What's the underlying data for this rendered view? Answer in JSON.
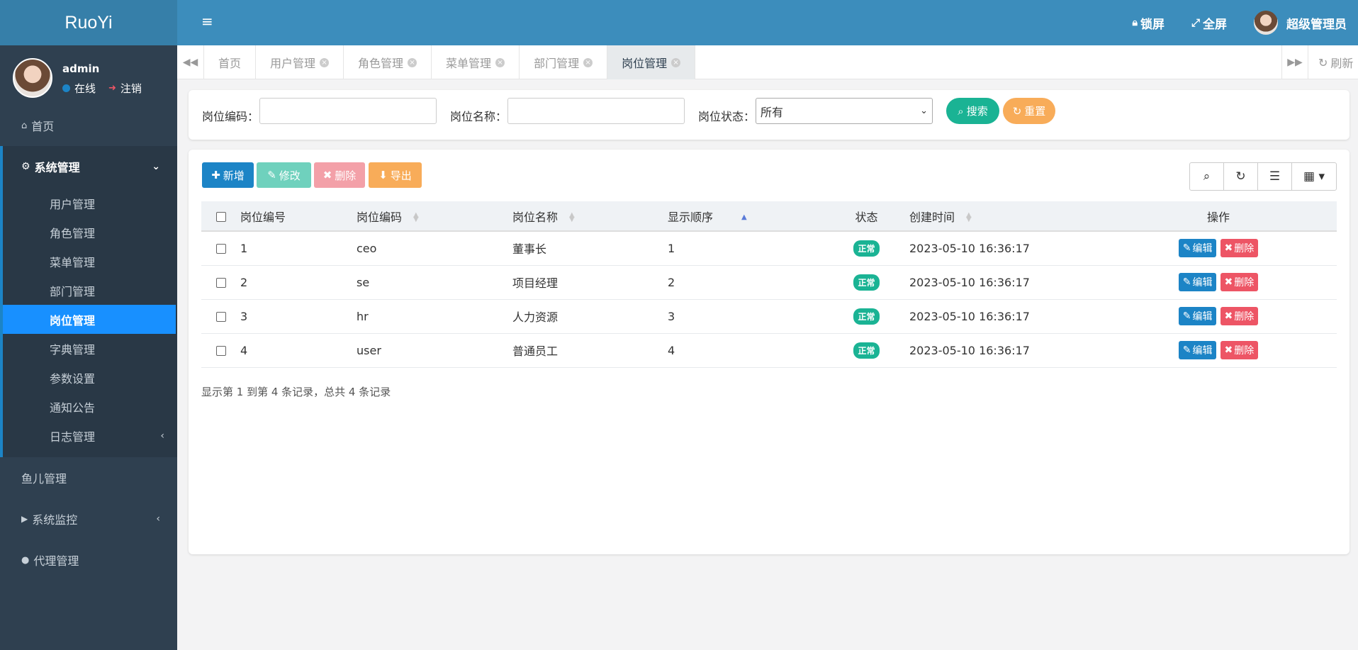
{
  "brand": "RuoYi",
  "user": {
    "name": "admin",
    "status": "在线",
    "logout": "注销"
  },
  "sidebar": {
    "home": "首页",
    "system": "系统管理",
    "system_items": [
      "用户管理",
      "角色管理",
      "菜单管理",
      "部门管理",
      "岗位管理",
      "字典管理",
      "参数设置",
      "通知公告",
      "日志管理"
    ],
    "fish": "鱼儿管理",
    "monitor": "系统监控",
    "agent": "代理管理"
  },
  "header": {
    "lock": "锁屏",
    "fullscreen": "全屏",
    "username": "超级管理员"
  },
  "tabs": [
    "首页",
    "用户管理",
    "角色管理",
    "菜单管理",
    "部门管理",
    "岗位管理"
  ],
  "tab_refresh": "刷新",
  "search": {
    "code_label": "岗位编码：",
    "name_label": "岗位名称：",
    "status_label": "岗位状态：",
    "status_value": "所有",
    "search_btn": "搜索",
    "reset_btn": "重置"
  },
  "toolbar": {
    "add": "新增",
    "edit": "修改",
    "delete": "删除",
    "export": "导出"
  },
  "table": {
    "headers": [
      "岗位编号",
      "岗位编码",
      "岗位名称",
      "显示顺序",
      "状态",
      "创建时间",
      "操作"
    ],
    "rows": [
      {
        "id": "1",
        "code": "ceo",
        "name": "董事长",
        "order": "1",
        "status": "正常",
        "created": "2023-05-10 16:36:17"
      },
      {
        "id": "2",
        "code": "se",
        "name": "项目经理",
        "order": "2",
        "status": "正常",
        "created": "2023-05-10 16:36:17"
      },
      {
        "id": "3",
        "code": "hr",
        "name": "人力资源",
        "order": "3",
        "status": "正常",
        "created": "2023-05-10 16:36:17"
      },
      {
        "id": "4",
        "code": "user",
        "name": "普通员工",
        "order": "4",
        "status": "正常",
        "created": "2023-05-10 16:36:17"
      }
    ],
    "edit_label": "编辑",
    "delete_label": "删除"
  },
  "pagination_text": "显示第 1 到第 4 条记录，总共 4 条记录",
  "colors": {
    "sidebar": "#2f4050",
    "header": "#3c8dbc",
    "primary": "#1c84c6",
    "success": "#1ab394",
    "danger": "#ed5565",
    "warning": "#f8ac59"
  }
}
